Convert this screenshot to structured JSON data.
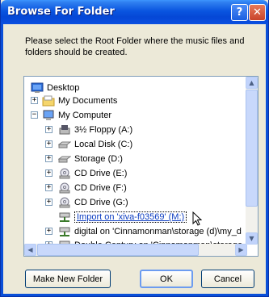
{
  "window": {
    "title": "Browse For Folder",
    "help_label": "?",
    "close_label": "✕"
  },
  "instructions": "Please select the Root Folder where the music files and folders should be created.",
  "tree": [
    {
      "label": "Desktop",
      "icon": "desktop-icon",
      "expander": "",
      "selected": false
    },
    {
      "label": "My Documents",
      "icon": "folder-icon",
      "expander": "+",
      "selected": false
    },
    {
      "label": "My Computer",
      "icon": "computer-icon",
      "expander": "−",
      "selected": false
    },
    {
      "label": "3½ Floppy (A:)",
      "icon": "floppy-drive-icon",
      "expander": "+",
      "selected": false
    },
    {
      "label": "Local Disk (C:)",
      "icon": "hard-disk-icon",
      "expander": "+",
      "selected": false
    },
    {
      "label": "Storage (D:)",
      "icon": "hard-disk-icon",
      "expander": "+",
      "selected": false
    },
    {
      "label": "CD Drive (E:)",
      "icon": "cd-drive-icon",
      "expander": "+",
      "selected": false
    },
    {
      "label": "CD Drive (F:)",
      "icon": "cd-drive-icon",
      "expander": "+",
      "selected": false
    },
    {
      "label": "CD Drive (G:)",
      "icon": "cd-drive-icon",
      "expander": "+",
      "selected": false
    },
    {
      "label": "Import on 'xiva-f03569' (M:)",
      "icon": "network-drive-icon",
      "expander": "",
      "selected": true
    },
    {
      "label": "digital on 'Cinnamonman\\storage (d)\\my_d",
      "icon": "network-drive-icon",
      "expander": "+",
      "selected": false
    },
    {
      "label": "Double Century on 'Cinnamonman\\storage",
      "icon": "network-drive-icon",
      "expander": "+",
      "selected": false
    }
  ],
  "buttons": {
    "new_folder": "Make New Folder",
    "ok": "OK",
    "cancel": "Cancel"
  }
}
